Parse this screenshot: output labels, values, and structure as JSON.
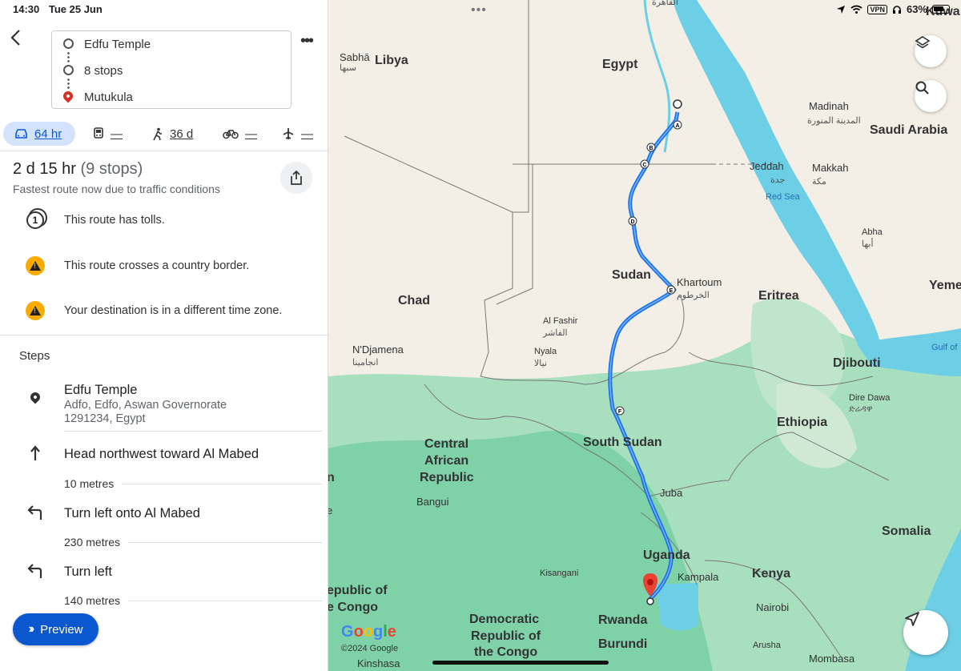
{
  "status_bar": {
    "time": "14:30",
    "date": "Tue 25 Jun",
    "vpn": "VPN",
    "battery": "63%"
  },
  "directions": {
    "origin": "Edfu Temple",
    "stops": "8 stops",
    "destination": "Mutukula",
    "more_icon": "more-horizontal-icon"
  },
  "modes": [
    {
      "icon": "car-icon",
      "value": "64 hr",
      "active": true
    },
    {
      "icon": "transit-icon",
      "value": "—"
    },
    {
      "icon": "walk-icon",
      "value": "36 d"
    },
    {
      "icon": "bike-icon",
      "value": "—"
    },
    {
      "icon": "flight-icon",
      "value": "—"
    }
  ],
  "summary": {
    "duration": "2 d 15 hr",
    "stops": "(9 stops)",
    "subtitle": "Fastest route now due to traffic conditions"
  },
  "notices": [
    {
      "icon": "toll-icon",
      "text": "This route has tolls."
    },
    {
      "icon": "warning-icon",
      "text": "This route crosses a country border."
    },
    {
      "icon": "warning-icon",
      "text": "Your destination is in a different time zone."
    }
  ],
  "steps_header": "Steps",
  "steps": [
    {
      "icon": "pin-icon",
      "title": "Edfu Temple",
      "address_line1": "Adfo, Edfo, Aswan Governorate",
      "address_line2": "1291234, Egypt"
    },
    {
      "icon": "arrow-up-icon",
      "title": "Head northwest toward Al Mabed",
      "distance": "10 metres"
    },
    {
      "icon": "turn-left-icon",
      "title": "Turn left onto Al Mabed",
      "distance": "230 metres"
    },
    {
      "icon": "turn-left-icon",
      "title": "Turn left",
      "distance": "140 metres"
    }
  ],
  "preview_button": "Preview",
  "map": {
    "labels": {
      "egypt_ar": "القاهرة",
      "sabha": "Sabhā",
      "sabha_ar": "سبها",
      "libya": "Libya",
      "egypt": "Egypt",
      "madinah": "Madinah",
      "madinah_ar": "المدينة المنورة",
      "saudi": "Saudi Arabia",
      "jeddah": "Jeddah",
      "jeddah_ar": "جدة",
      "makkah": "Makkah",
      "makkah_ar": "مكة",
      "red_sea": "Red Sea",
      "abha": "Abha",
      "abha_ar": "أبها",
      "yemen": "Yeme",
      "sudan": "Sudan",
      "khartoum": "Khartoum",
      "khartoum_ar": "الخرطوم",
      "eritrea": "Eritrea",
      "chad": "Chad",
      "al_fashir": "Al Fashir",
      "al_fashir_ar": "الفاشر",
      "nyala": "Nyala",
      "nyala_ar": "نيالا",
      "ndjamena": "N'Djamena",
      "ndjamena_ar": "انجامينا",
      "gulf": "Gulf of",
      "djibouti": "Djibouti",
      "dire_dawa": "Dire Dawa",
      "dire_dawa_am": "ድሬዳዋ",
      "ethiopia": "Ethiopia",
      "car1": "Central",
      "car2": "African",
      "car3": "Republic",
      "south_sudan": "South Sudan",
      "juba": "Juba",
      "bangui": "Bangui",
      "somalia": "Somalia",
      "uganda": "Uganda",
      "kampala": "Kampala",
      "kenya": "Kenya",
      "kisangani": "Kisangani",
      "congo1": "epublic of",
      "congo2": "e Congo",
      "drc1": "Democratic",
      "drc2": "Republic of",
      "drc3": "the Congo",
      "rwanda": "Rwanda",
      "burundi": "Burundi",
      "nairobi": "Nairobi",
      "arusha": "Arusha",
      "mombasa": "Mombasa",
      "kinshasa": "Kinshasa",
      "kuwait": "Kuwa",
      "partial_n": "n",
      "partial_e": "e"
    },
    "waypoints": [
      "A",
      "B",
      "C",
      "D",
      "E",
      "F"
    ],
    "copyright": "©2024 Google",
    "layers_icon": "layers-icon",
    "search_icon": "search-icon",
    "nav_icon": "navigation-arrow-icon",
    "colors": {
      "route": "#1a73e8",
      "water": "#6ccfe6",
      "land": "#f3efe6",
      "forest": "#7fd1a8"
    }
  }
}
